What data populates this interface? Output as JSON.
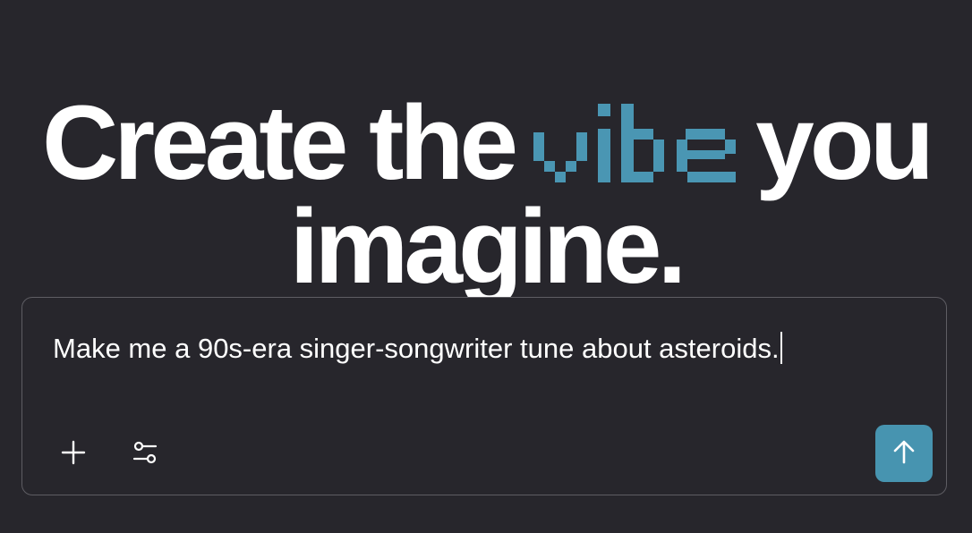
{
  "headline": {
    "before_highlight": "Create the",
    "highlight_word": "vibe",
    "after_highlight": "you",
    "line2": "imagine."
  },
  "prompt": {
    "value": "Make me a 90s-era singer-songwriter tune about asteroids."
  },
  "toolbar": {
    "add_icon": "plus-icon",
    "settings_icon": "sliders-icon",
    "send_icon": "arrow-up-icon"
  },
  "colors": {
    "background": "#27262c",
    "accent": "#4794b0",
    "highlight_word": "#4a96b3",
    "border": "#5e5d63",
    "text": "#ffffff"
  }
}
